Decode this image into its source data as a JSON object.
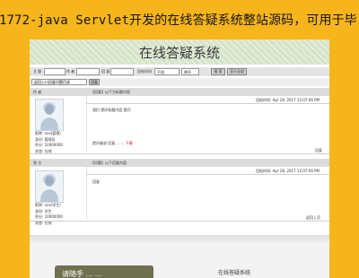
{
  "banner": {
    "title": "1772-java Servlet开发的在线答疑系统整站源码，可用于毕"
  },
  "app": {
    "title": "在线答疑系统"
  },
  "search": {
    "topic_label": "主 题",
    "author_label": "作 者",
    "time_label": "回 复",
    "board_label": "回帖时间",
    "board_value": "不限",
    "order_value": "降序",
    "search_button": "搜 索",
    "advanced_button": "显示全部"
  },
  "tabbar": {
    "label": "返回入口回复问题目录",
    "extra": "回复"
  },
  "posts": [
    {
      "author_label": "作 者",
      "title": "【回复】以下为标题内容",
      "time": "回帖时间: Apr 28, 2017 12:07:06 PM",
      "content": "我们 提问标题内容 提问",
      "info": [
        "昵称: xxx(管理)",
        "身份: 管理员",
        "积分: 10000000",
        "状态: 在线"
      ],
      "sign": "提问者说 回复 ... ...",
      "sign_red": "下载",
      "bottom_link": "回复"
    },
    {
      "author_label": "答 主",
      "title": "【问题】以下回复内容",
      "time": "回帖时间: Apr 28, 2017 12:07:06 PM",
      "content": "回复",
      "info": [
        "昵称: xxx(学生)",
        "身份: 学生",
        "积分: 10000000",
        "状态: 在线"
      ],
      "sign": "",
      "sign_red": "",
      "bottom_link": "返回上页"
    }
  ],
  "footer": {
    "ad": "请随手 ... ...",
    "text": "在线答疑系统"
  }
}
